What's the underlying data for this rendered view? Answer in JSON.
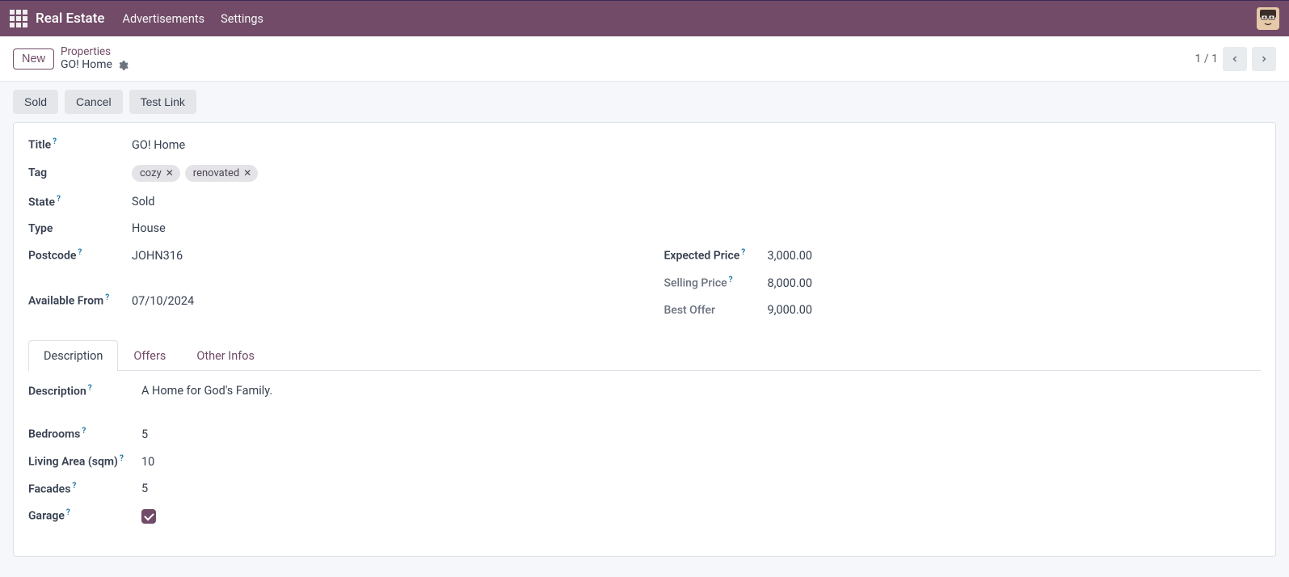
{
  "nav": {
    "app_title": "Real Estate",
    "links": [
      "Advertisements",
      "Settings"
    ]
  },
  "control": {
    "new_label": "New",
    "crumb_top": "Properties",
    "crumb_current": "GO! Home",
    "pager_text": "1 / 1"
  },
  "statusbar": {
    "buttons": [
      "Sold",
      "Cancel",
      "Test Link"
    ]
  },
  "form": {
    "title_label": "Title",
    "title_value": "GO! Home",
    "tag_label": "Tag",
    "tags": [
      "cozy",
      "renovated"
    ],
    "state_label": "State",
    "state_value": "Sold",
    "type_label": "Type",
    "type_value": "House",
    "postcode_label": "Postcode",
    "postcode_value": "JOHN316",
    "available_from_label": "Available From",
    "available_from_value": "07/10/2024",
    "expected_price_label": "Expected Price",
    "expected_price_value": "3,000.00",
    "selling_price_label": "Selling Price",
    "selling_price_value": "8,000.00",
    "best_offer_label": "Best Offer",
    "best_offer_value": "9,000.00"
  },
  "tabs": {
    "items": [
      "Description",
      "Offers",
      "Other Infos"
    ],
    "active_index": 0
  },
  "desc": {
    "description_label": "Description",
    "description_value": "A Home for God's Family.",
    "bedrooms_label": "Bedrooms",
    "bedrooms_value": "5",
    "living_area_label": "Living Area (sqm)",
    "living_area_value": "10",
    "facades_label": "Facades",
    "facades_value": "5",
    "garage_label": "Garage",
    "garage_value": true
  }
}
